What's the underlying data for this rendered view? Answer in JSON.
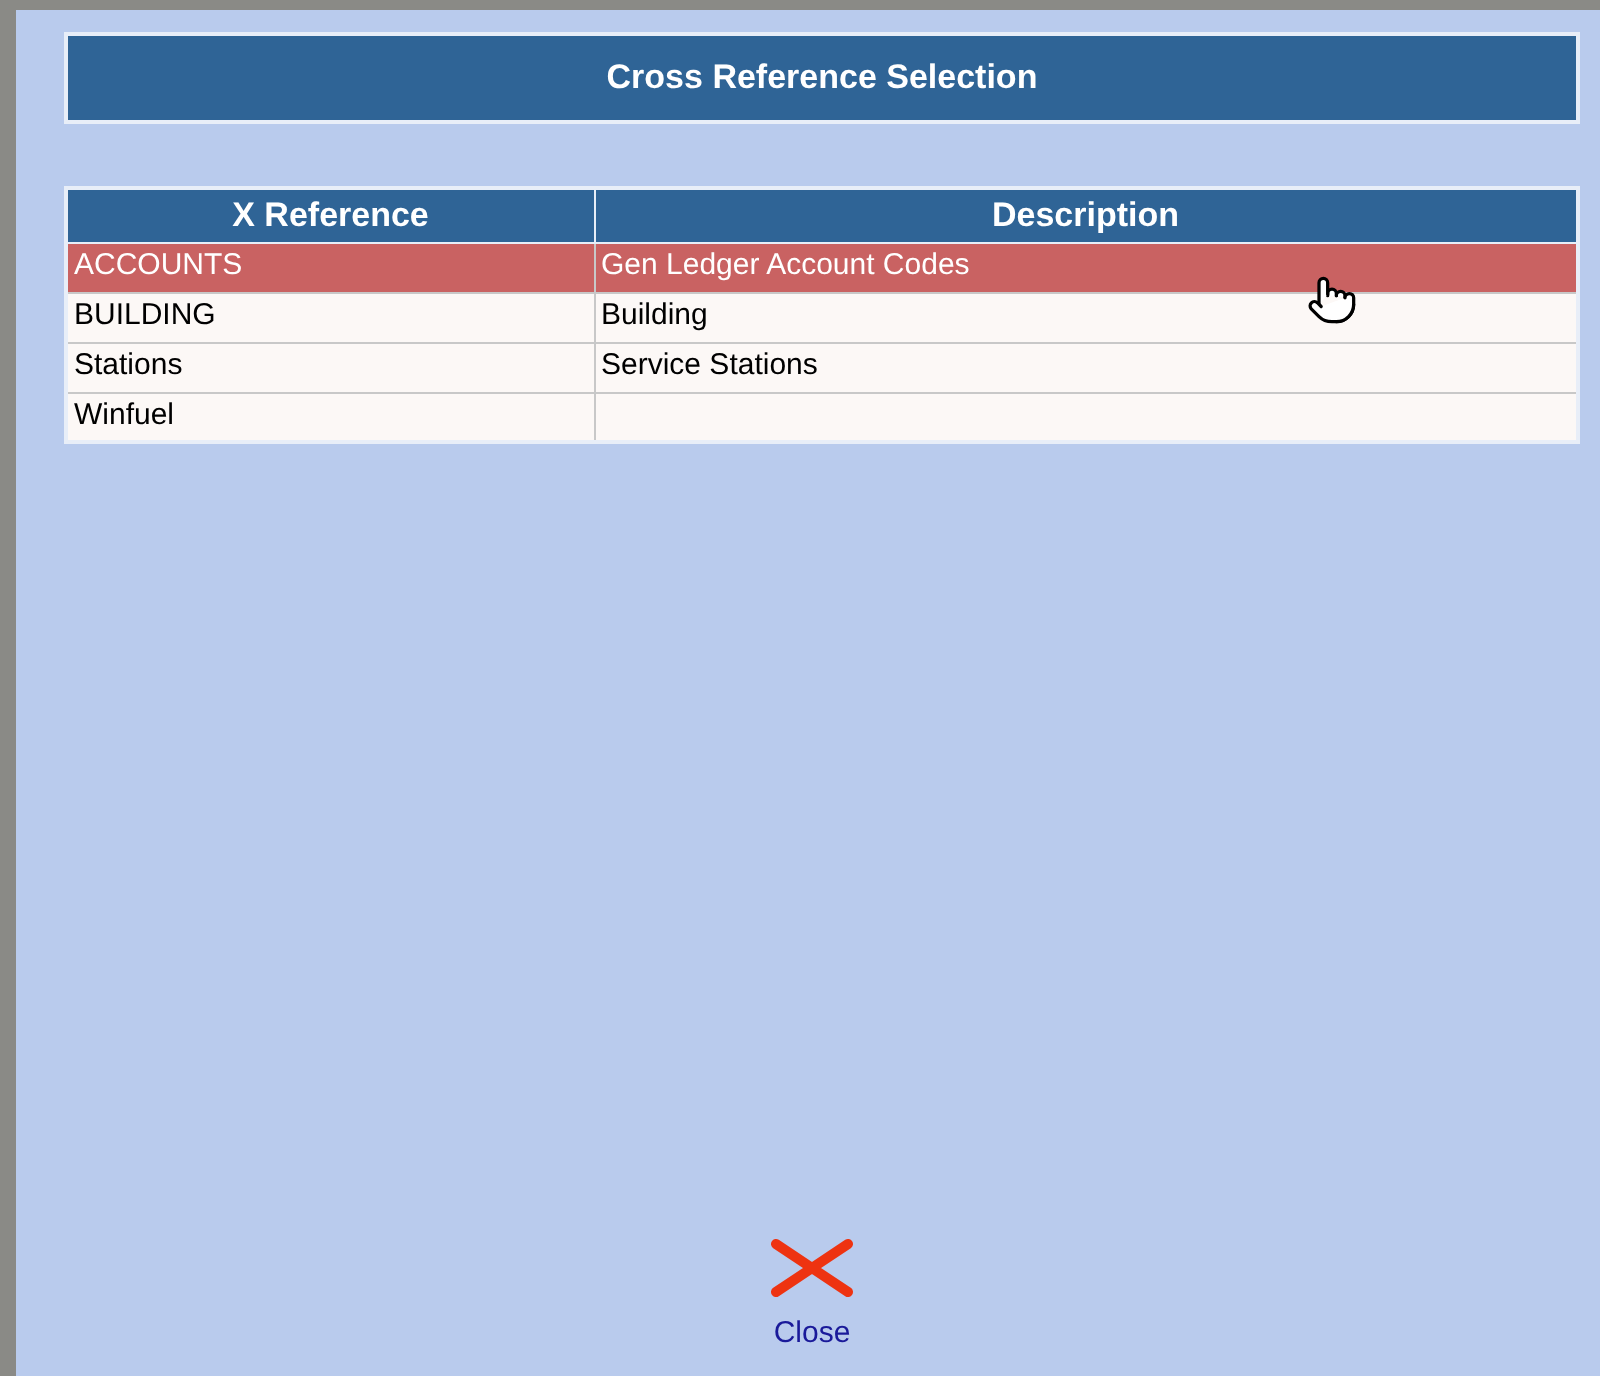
{
  "title": "Cross Reference Selection",
  "table": {
    "columns": [
      "X Reference",
      "Description"
    ],
    "rows": [
      {
        "cells": [
          "ACCOUNTS",
          "Gen Ledger Account Codes"
        ],
        "selected": true
      },
      {
        "cells": [
          "BUILDING",
          "Building"
        ],
        "selected": false
      },
      {
        "cells": [
          "Stations",
          "Service Stations"
        ],
        "selected": false
      },
      {
        "cells": [
          "Winfuel",
          ""
        ],
        "selected": false
      }
    ]
  },
  "close_button": "Close"
}
